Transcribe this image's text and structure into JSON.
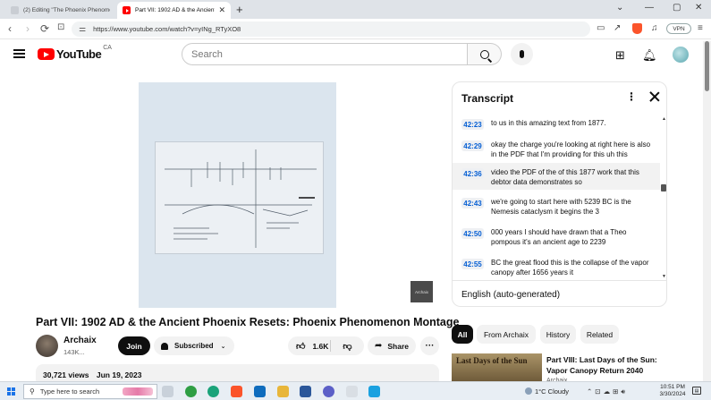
{
  "browser": {
    "tabs": [
      {
        "title": "(2) Editing \"The Phoenix Phenomenon M",
        "active": false
      },
      {
        "title": "Part VII: 1902 AD & the Ancient",
        "active": true
      }
    ],
    "new_tab": "+",
    "url": "https://www.youtube.com/watch?v=yINg_RTyXO8",
    "vpn_label": "VPN",
    "nav": {
      "back": "‹",
      "forward": "›",
      "reload": "⟳"
    }
  },
  "youtube": {
    "logo_text": "YouTube",
    "country": "CA",
    "search_placeholder": "Search"
  },
  "transcript": {
    "title": "Transcript",
    "language": "English (auto-generated)",
    "segments": [
      {
        "time": "42:23",
        "text": "to us in this amazing text from 1877."
      },
      {
        "time": "42:29",
        "text": "okay the charge you're looking at right here is also in the PDF that I'm providing for this uh this"
      },
      {
        "time": "42:36",
        "text": "video the PDF of the of this 1877 work that this debtor data demonstrates so",
        "active": true
      },
      {
        "time": "42:43",
        "text": "we're going to start here with 5239 BC is the Nemesis cataclysm it begins the 3"
      },
      {
        "time": "42:50",
        "text": "000 years I should have drawn that a Theo pompous it's an ancient age to 2239"
      },
      {
        "time": "42:55",
        "text": "BC the great flood this is the collapse of the vapor canopy after 1656 years it"
      }
    ]
  },
  "video": {
    "title": "Part VII: 1902 AD & the Ancient Phoenix Resets: Phoenix Phenomenon Montage",
    "watermark": "Archaix",
    "channel": {
      "name": "Archaix",
      "subscribers": "143K..."
    },
    "join_label": "Join",
    "subscribed_label": "Subscribed",
    "likes": "1.6K",
    "share_label": "Share",
    "views": "30,721 views",
    "date": "Jun 19, 2023"
  },
  "chips": [
    "All",
    "From Archaix",
    "History",
    "Related"
  ],
  "related": [
    {
      "title": "Part VIII: Last Days of the Sun: Vapor Canopy Return 2040",
      "channel": "Archaix",
      "thumb_text": "Last Days of the Sun"
    }
  ],
  "taskbar": {
    "search_placeholder": "Type here to search",
    "weather": "1°C  Cloudy",
    "time": "10:51 PM",
    "date": "3/30/2024"
  },
  "colors": {
    "accent": "#ff0000",
    "link": "#065fd4",
    "chip_active": "#0f0f0f"
  }
}
